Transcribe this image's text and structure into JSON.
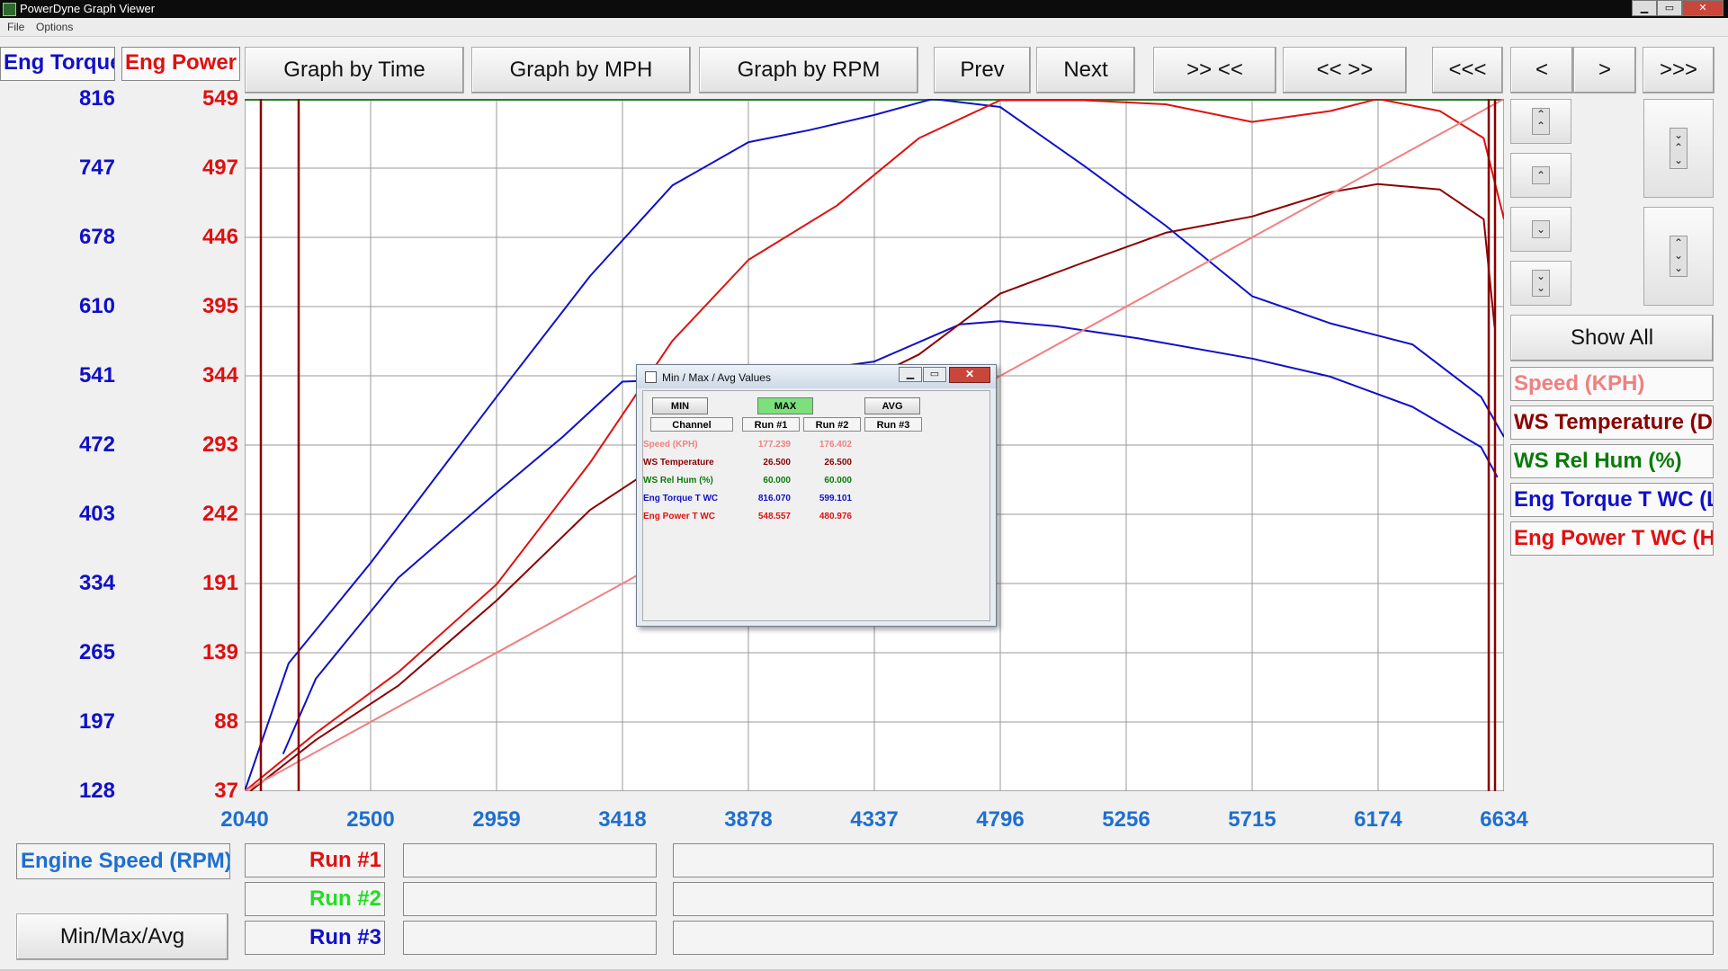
{
  "window": {
    "title": "PowerDyne Graph Viewer",
    "minimize": "▁",
    "maximize": "▭",
    "close": "✕"
  },
  "menu": {
    "file": "File",
    "options": "Options"
  },
  "colors": {
    "blue": "#1010c8",
    "red": "#e01010",
    "darkred": "#8b0000",
    "pink": "#f08080",
    "green": "#0a7a0a",
    "xaxis": "#1e6fd0"
  },
  "headers": {
    "torque": "Eng Torque T WC",
    "power": "Eng Power T WC"
  },
  "toolbar": {
    "graph_by_time": "Graph by Time",
    "graph_by_mph": "Graph by MPH",
    "graph_by_rpm": "Graph by RPM",
    "prev": "Prev",
    "next": "Next",
    "zoom_in": ">> <<",
    "zoom_out": "<< >>",
    "first": "<<<",
    "back": "<",
    "forward": ">",
    "last": ">>>"
  },
  "side": {
    "up_fast_icon": "double-chevron-up-icon",
    "up_icon": "chevron-up-icon",
    "down_icon": "chevron-down-icon",
    "down_fast_icon": "double-chevron-down-icon",
    "show_all": "Show All"
  },
  "legend": [
    {
      "label": "Speed (KPH)",
      "color": "#f08080"
    },
    {
      "label": "WS Temperature (DEG C)",
      "color": "#8b0000"
    },
    {
      "label": "WS Rel Hum (%)",
      "color": "#0a7a0a"
    },
    {
      "label": "Eng Torque T WC (LB-FT)",
      "color": "#1010c8"
    },
    {
      "label": "Eng Power T WC (HP)",
      "color": "#e01010"
    }
  ],
  "bottom": {
    "xaxis_channel": "Engine Speed (RPM)",
    "min_max_avg": "Min/Max/Avg",
    "runs": [
      {
        "label": "Run #1",
        "color": "#e01010"
      },
      {
        "label": "Run #2",
        "color": "#22dd22"
      },
      {
        "label": "Run #3",
        "color": "#1010c8"
      }
    ]
  },
  "dialog": {
    "title": "Min / Max / Avg Values",
    "min": "MIN",
    "max": "MAX",
    "avg": "AVG",
    "columns": [
      "Channel",
      "Run #1",
      "Run #2",
      "Run #3"
    ],
    "rows": [
      {
        "channel": "Speed (KPH)",
        "run1": "177.239",
        "run2": "176.402",
        "run3": "",
        "color": "#f08080"
      },
      {
        "channel": "WS Temperature",
        "run1": "26.500",
        "run2": "26.500",
        "run3": "",
        "color": "#8b0000"
      },
      {
        "channel": "WS Rel Hum (%)",
        "run1": "60.000",
        "run2": "60.000",
        "run3": "",
        "color": "#0a7a0a"
      },
      {
        "channel": "Eng Torque T WC",
        "run1": "816.070",
        "run2": "599.101",
        "run3": "",
        "color": "#1010c8"
      },
      {
        "channel": "Eng Power T WC",
        "run1": "548.557",
        "run2": "480.976",
        "run3": "",
        "color": "#e01010"
      }
    ]
  },
  "chart_data": {
    "type": "line",
    "xlabel": "Engine Speed (RPM)",
    "x_ticks": [
      "2040",
      "2500",
      "2959",
      "3418",
      "3878",
      "4337",
      "4796",
      "5256",
      "5715",
      "6174",
      "6634"
    ],
    "xlim": [
      2040,
      6634
    ],
    "y_torque_ticks": [
      "816",
      "747",
      "678",
      "610",
      "541",
      "472",
      "403",
      "334",
      "265",
      "197",
      "128"
    ],
    "y_torque_lim": [
      128,
      816
    ],
    "y_power_ticks": [
      "549",
      "497",
      "446",
      "395",
      "344",
      "293",
      "242",
      "191",
      "139",
      "88",
      "37"
    ],
    "y_power_lim": [
      37,
      549
    ],
    "grid": true,
    "series": [
      {
        "name": "Eng Torque T WC",
        "run": "Run #1",
        "axis": "torque",
        "color": "#1010c8",
        "x": [
          2040,
          2200,
          2500,
          2959,
          3300,
          3600,
          3878,
          4100,
          4337,
          4550,
          4796,
          5100,
          5400,
          5715,
          6000,
          6300,
          6550,
          6634
        ],
        "y": [
          128,
          255,
          355,
          520,
          640,
          730,
          773,
          785,
          800,
          816,
          808,
          750,
          690,
          620,
          593,
          572,
          520,
          480
        ]
      },
      {
        "name": "Eng Torque T WC",
        "run": "Run #2",
        "axis": "torque",
        "color": "#1010c8",
        "x": [
          2180,
          2300,
          2600,
          2959,
          3200,
          3418,
          3700,
          4000,
          4337,
          4650,
          4796,
          5000,
          5300,
          5715,
          6000,
          6300,
          6550,
          6610
        ],
        "y": [
          165,
          240,
          340,
          425,
          480,
          535,
          538,
          542,
          555,
          592,
          595,
          590,
          578,
          558,
          540,
          510,
          470,
          440
        ]
      },
      {
        "name": "Eng Power T WC",
        "run": "Run #1",
        "axis": "power",
        "color": "#e01010",
        "x": [
          2040,
          2300,
          2600,
          2959,
          3300,
          3600,
          3878,
          4200,
          4500,
          4796,
          5100,
          5400,
          5715,
          6000,
          6174,
          6400,
          6560,
          6634
        ],
        "y": [
          37,
          80,
          125,
          190,
          280,
          370,
          430,
          470,
          520,
          548,
          548,
          545,
          532,
          540,
          549,
          540,
          520,
          460
        ]
      },
      {
        "name": "Eng Power T WC",
        "run": "Run #2",
        "axis": "power",
        "color": "#8b0000",
        "x": [
          2060,
          2300,
          2600,
          2959,
          3300,
          3600,
          3878,
          4200,
          4500,
          4796,
          5100,
          5400,
          5715,
          6000,
          6174,
          6400,
          6560,
          6600
        ],
        "y": [
          37,
          75,
          115,
          178,
          245,
          285,
          305,
          330,
          360,
          405,
          428,
          450,
          462,
          480,
          486,
          482,
          460,
          380
        ]
      },
      {
        "name": "Speed (KPH)",
        "run": "Run #1",
        "axis": "power",
        "color": "#f08080",
        "x": [
          2040,
          6634
        ],
        "y": [
          37,
          549
        ]
      }
    ]
  }
}
